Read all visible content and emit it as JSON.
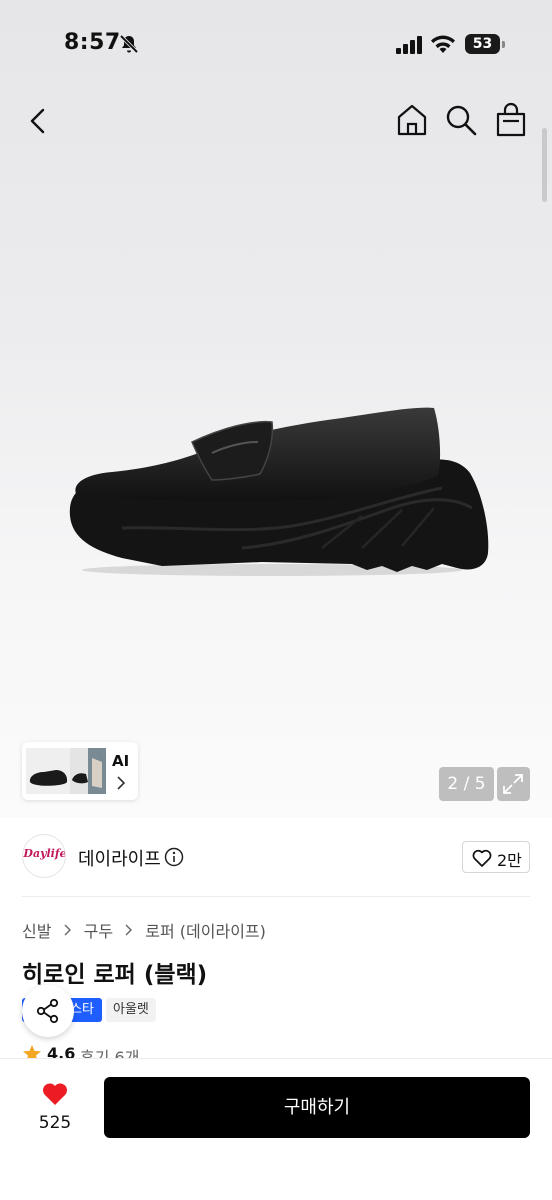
{
  "status_bar": {
    "time": "8:57",
    "battery": "53",
    "icons": [
      "bell-off-icon",
      "signal-icon",
      "wifi-icon",
      "battery-icon"
    ]
  },
  "nav": {
    "icons": [
      "back-arrow-icon",
      "home-icon",
      "search-icon",
      "shopping-bag-icon"
    ]
  },
  "gallery": {
    "ai_label": "AI",
    "counter": "2 / 5",
    "current_index": 2,
    "total": 5,
    "expand_icon": "expand-icon"
  },
  "brand": {
    "logo_text": "Daylife",
    "name": "데이라이프",
    "info_icon": "info-icon",
    "likes": "2만"
  },
  "breadcrumb": [
    "신발",
    "구두",
    "로퍼 (데이라이프)"
  ],
  "product": {
    "title": "히로인 로퍼 (블랙)",
    "tags": [
      "스타",
      "아울렛"
    ],
    "rating": "4.6",
    "reviews": "후기 6개"
  },
  "bottom_bar": {
    "wish_count": "525",
    "buy_label": "구매하기"
  },
  "colors": {
    "accent_blue": "#1e5eff",
    "heart_red": "#ec1c24",
    "star_orange": "#f5a623",
    "buy_button": "#000000"
  }
}
